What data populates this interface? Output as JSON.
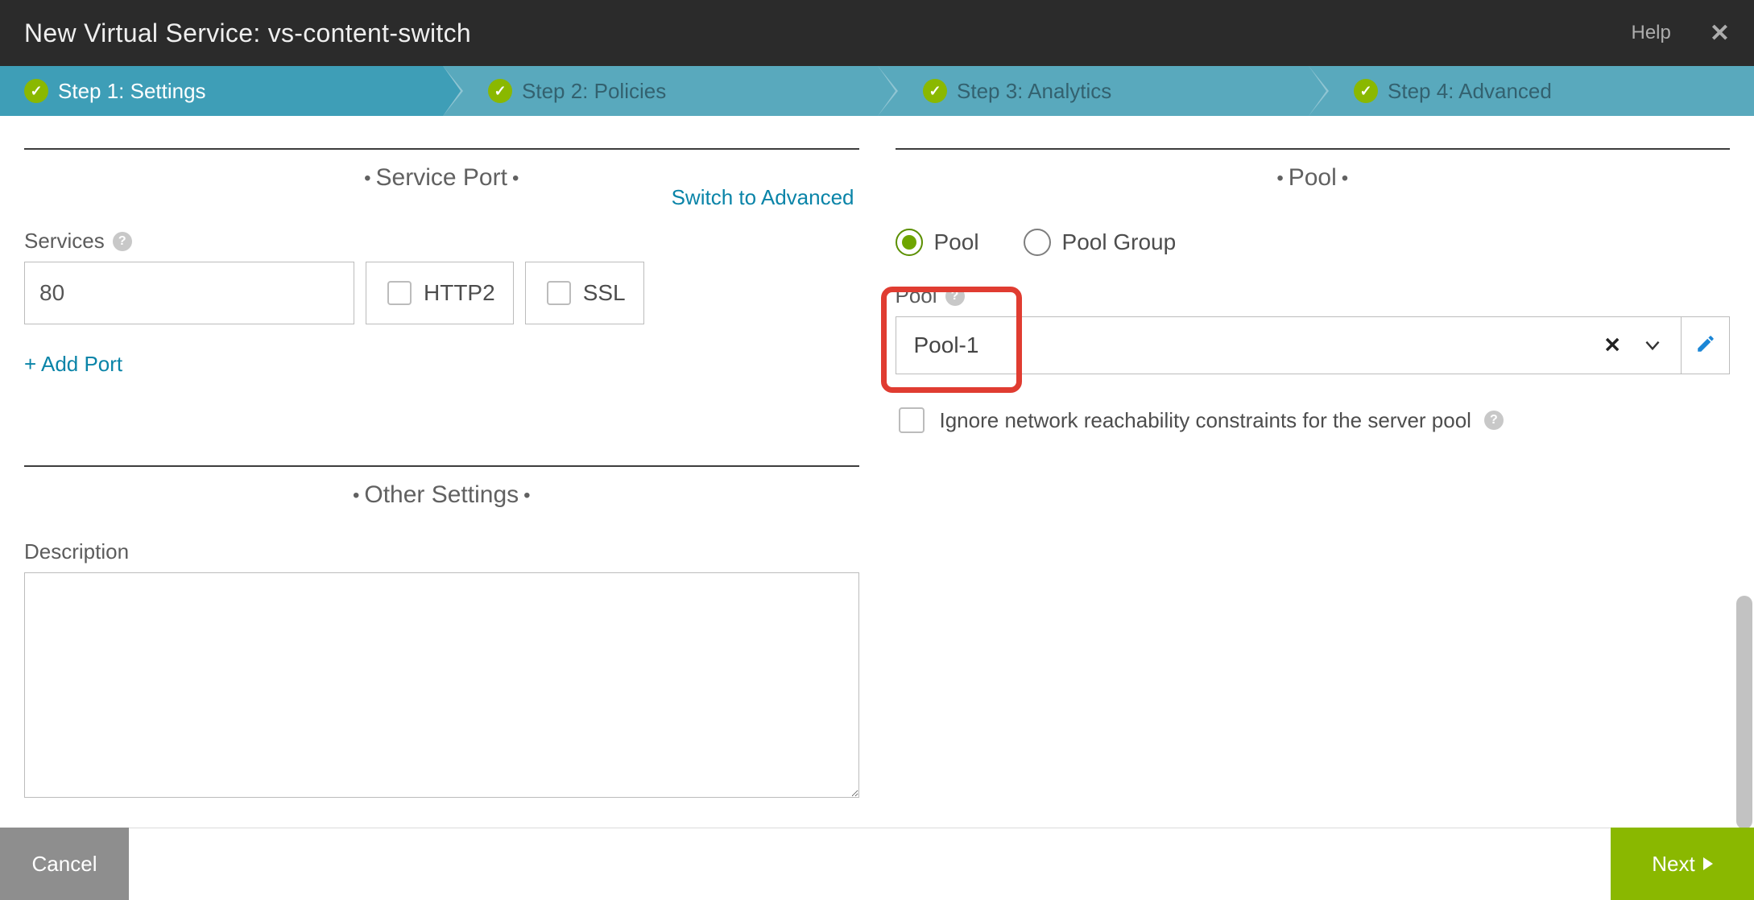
{
  "header": {
    "title": "New Virtual Service: vs-content-switch",
    "help_label": "Help"
  },
  "steps": [
    {
      "label": "Step 1: Settings"
    },
    {
      "label": "Step 2: Policies"
    },
    {
      "label": "Step 3: Analytics"
    },
    {
      "label": "Step 4: Advanced"
    }
  ],
  "left": {
    "service_port_title": "Service Port",
    "switch_to_advanced": "Switch to Advanced",
    "services_label": "Services",
    "port_value": "80",
    "http2_label": "HTTP2",
    "ssl_label": "SSL",
    "add_port": "+ Add Port",
    "other_settings_title": "Other Settings",
    "description_label": "Description",
    "description_value": ""
  },
  "right": {
    "pool_title": "Pool",
    "radio_pool": "Pool",
    "radio_pool_group": "Pool Group",
    "pool_field_label": "Pool",
    "pool_selected": "Pool-1",
    "ignore_label": "Ignore network reachability constraints for the server pool"
  },
  "footer": {
    "cancel": "Cancel",
    "next": "Next"
  }
}
